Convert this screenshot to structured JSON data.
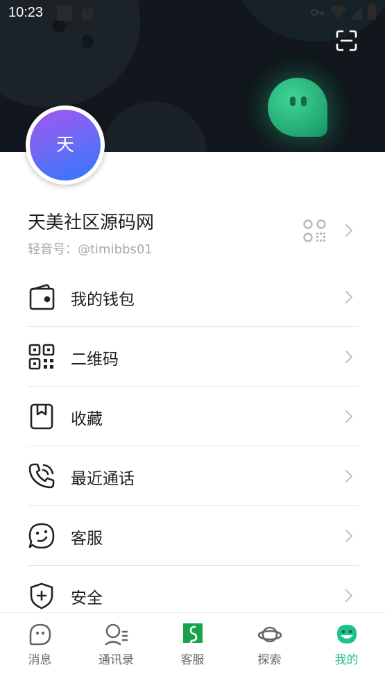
{
  "status_bar": {
    "time": "10:23"
  },
  "profile": {
    "avatar_text": "天",
    "name": "天美社区源码网",
    "id_label": "轻音号：",
    "id_value": "@timibbs01"
  },
  "menu": [
    {
      "label": "我的钱包",
      "icon": "wallet-icon"
    },
    {
      "label": "二维码",
      "icon": "qrcode-icon"
    },
    {
      "label": "收藏",
      "icon": "bookmark-icon"
    },
    {
      "label": "最近通话",
      "icon": "phone-call-icon"
    },
    {
      "label": "客服",
      "icon": "smiley-chat-icon"
    },
    {
      "label": "安全",
      "icon": "shield-plus-icon"
    }
  ],
  "tabbar": [
    {
      "label": "消息",
      "icon": "chat-bubble-icon"
    },
    {
      "label": "通讯录",
      "icon": "contacts-icon"
    },
    {
      "label": "客服",
      "icon": "service-logo-icon"
    },
    {
      "label": "探索",
      "icon": "planet-icon"
    },
    {
      "label": "我的",
      "icon": "me-icon",
      "active": true
    }
  ],
  "colors": {
    "accent": "#1ec28b",
    "header_bg": "#11171c",
    "avatar_gradient_start": "#a455f0",
    "avatar_gradient_end": "#2f78fb",
    "service_logo": "#16a34a"
  }
}
